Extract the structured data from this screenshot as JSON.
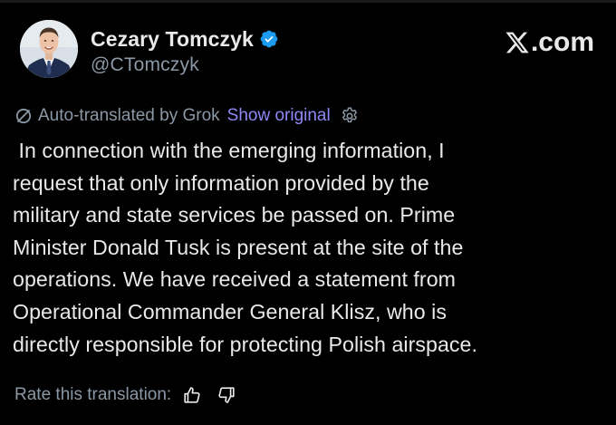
{
  "post": {
    "author": {
      "display_name": "Cezary Tomczyk",
      "handle": "@CTomczyk",
      "verified": true,
      "verified_color": "#1d9bf0",
      "avatar_icon": "person-portrait"
    },
    "brand": {
      "logo_icon": "x-logo-icon",
      "domain": ".com"
    },
    "translation": {
      "icon": "grok-slash-icon",
      "label": "Auto-translated by Grok",
      "show_original_label": "Show original",
      "settings_icon": "settings-gear-icon",
      "link_color": "#8f88f5"
    },
    "text": " In connection with the emerging information, I\nrequest that only information provided by the\nmilitary and state services be passed on. Prime\nMinister Donald Tusk is present at the site of the\noperations. We have received a statement from\nOperational Commander General Klisz, who is\ndirectly responsible for protecting Polish airspace.",
    "rating": {
      "label": "Rate this translation:",
      "thumbs_up_icon": "thumbs-up-icon",
      "thumbs_down_icon": "thumbs-down-icon"
    }
  }
}
